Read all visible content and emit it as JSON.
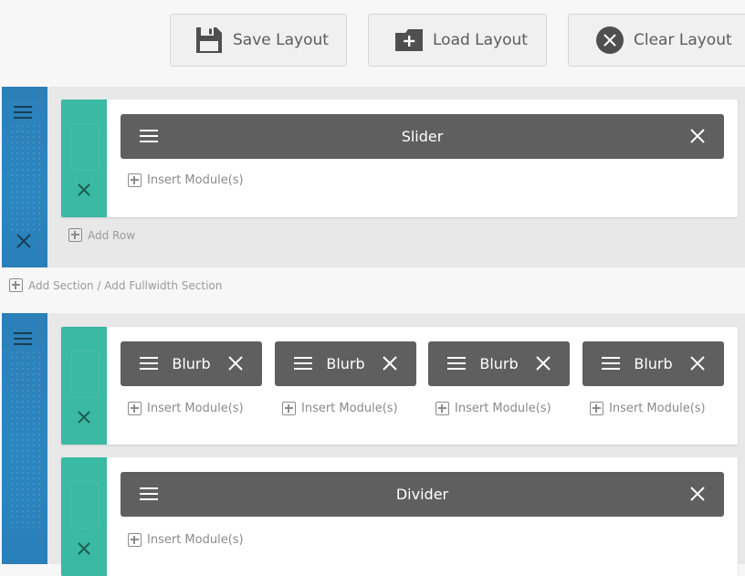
{
  "toolbar": {
    "save_label": "Save Layout",
    "load_label": "Load Layout",
    "clear_label": "Clear Layout"
  },
  "add_section_label": "Add Section / Add Fullwidth Section",
  "sections": [
    {
      "rows": [
        {
          "modules": [
            {
              "label": "Slider"
            }
          ],
          "insert_label": "Insert Module(s)"
        }
      ],
      "add_row_label": "Add Row"
    },
    {
      "rows": [
        {
          "modules": [
            {
              "label": "Blurb"
            },
            {
              "label": "Blurb"
            },
            {
              "label": "Blurb"
            },
            {
              "label": "Blurb"
            }
          ],
          "insert_labels": [
            "Insert Module(s)",
            "Insert Module(s)",
            "Insert Module(s)",
            "Insert Module(s)"
          ]
        },
        {
          "modules": [
            {
              "label": "Divider"
            }
          ],
          "insert_label": "Insert Module(s)"
        }
      ]
    }
  ],
  "colors": {
    "section_handle": "#2b86c0",
    "row_handle": "#3ab9a4",
    "module_bg": "#5f5f5f"
  },
  "icons": {
    "save": "floppy-disk-icon",
    "load": "folder-plus-icon",
    "clear": "circle-x-icon",
    "drag": "hamburger-menu-icon",
    "remove": "close-icon",
    "insert": "plus-square-icon"
  }
}
